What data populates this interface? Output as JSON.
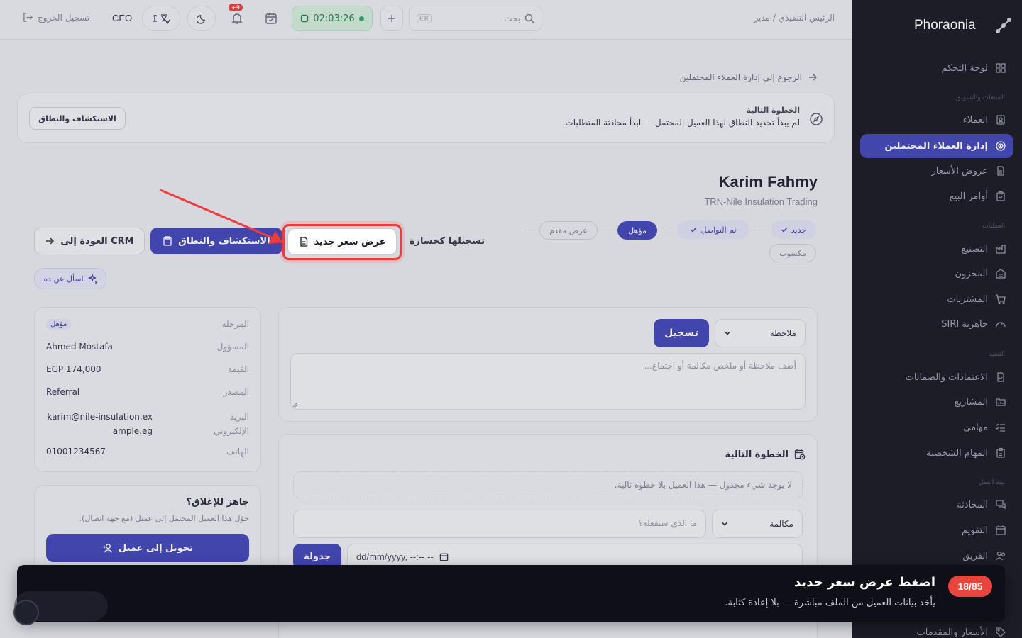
{
  "sidebar": {
    "brand": "Phoraonia",
    "items": [
      {
        "label": "لوحة التحكم",
        "icon": "dashboard-icon"
      },
      {
        "label": "العملاء",
        "icon": "contacts-icon"
      },
      {
        "label": "إدارة العملاء المحتملين",
        "icon": "target-icon",
        "active": true
      },
      {
        "label": "عروض الأسعار",
        "icon": "document-icon"
      },
      {
        "label": "أوامر البيع",
        "icon": "clipboard-icon"
      },
      {
        "label": "التصنيع",
        "icon": "factory-icon"
      },
      {
        "label": "المخزون",
        "icon": "warehouse-icon"
      },
      {
        "label": "المشتريات",
        "icon": "cart-icon"
      },
      {
        "label": "جاهزية SIRI",
        "icon": "gauge-icon"
      },
      {
        "label": "الاعتمادات والضمانات",
        "icon": "file-check-icon"
      },
      {
        "label": "المشاريع",
        "icon": "projects-icon"
      },
      {
        "label": "مهامي",
        "icon": "tasks-icon"
      },
      {
        "label": "المهام الشخصية",
        "icon": "clipboard-icon"
      },
      {
        "label": "المحادثة",
        "icon": "chat-icon"
      },
      {
        "label": "التقويم",
        "icon": "calendar-icon"
      },
      {
        "label": "الفريق",
        "icon": "team-icon"
      },
      {
        "label": "الأسعار والمقدمات",
        "icon": "tag-icon"
      }
    ],
    "sections": [
      "المبيعات والتسويق",
      "العمليات",
      "التنفيذ",
      "بيئة العمل"
    ]
  },
  "header": {
    "role": "الرئيس التنفيذي / مدير",
    "search_placeholder": "بحث",
    "search_kbd": "K⌘",
    "timer": "02:03:26",
    "notif_count": "+9",
    "user": "CEO",
    "logout": "تسجيل الخروج"
  },
  "main": {
    "back_link": "الرجوع إلى إدارة العملاء المحتملين",
    "next_step_title": "الخطوة التالية",
    "next_step_text": "لم يبدأ تحديد النطاق لهذا العميل المحتمل — ابدأ محادثة المتطلبات.",
    "next_step_button": "الاستكشاف والنطاق",
    "lead_name": "Karim Fahmy",
    "lead_company": "TRN-Nile Insulation Trading",
    "stages": [
      "جديد",
      "تم التواصل",
      "مؤهل",
      "عرض مقدم",
      "مكسوب"
    ],
    "btn_back_crm": "العودة إلى CRM",
    "btn_discovery": "الاستكشاف والنطاق",
    "btn_new_quote": "عرض سعر جديد",
    "btn_mark_lost": "تسجيلها كخسارة",
    "ask_button": "اسأل عن ده",
    "details": [
      {
        "label": "المرحلة",
        "value": "مؤهل"
      },
      {
        "label": "المسؤول",
        "value": "Ahmed Mostafa"
      },
      {
        "label": "القيمة",
        "value": "EGP 174,000"
      },
      {
        "label": "المصدر",
        "value": "Referral"
      },
      {
        "label": "البريد الإلكتروني",
        "value": "karim@nile-insulation.example.eg"
      },
      {
        "label": "الهاتف",
        "value": "01001234567"
      }
    ],
    "close_title": "جاهز للإغلاق؟",
    "close_text": "حوّل هذا العميل المحتمل إلى عميل (مع جهة اتصال).",
    "close_button": "تحويل إلى عميل",
    "note_type": "ملاحظة",
    "note_submit": "تسجيل",
    "note_placeholder": "أضف ملاحظة أو ملخص مكالمة أو اجتماع...",
    "next_title": "الخطوة التالية",
    "next_empty": "لا يوجد شيء مجدول — هذا العميل بلا خطوة تالية.",
    "next_type": "مكالمة",
    "next_placeholder": "ما الذي ستفعله؟",
    "next_date": "dd/mm/yyyy, --:-- --",
    "schedule_button": "جدولة"
  },
  "tour": {
    "counter": "18/85",
    "title": "اضغط عرض سعر جديد",
    "text": "يأخذ بيانات العميل من الملف مباشرة — بلا إعادة كتابة."
  },
  "colors": {
    "accent": "#3b3eb0",
    "highlight": "#ef3b3b",
    "sidebar": "#0f1018"
  }
}
